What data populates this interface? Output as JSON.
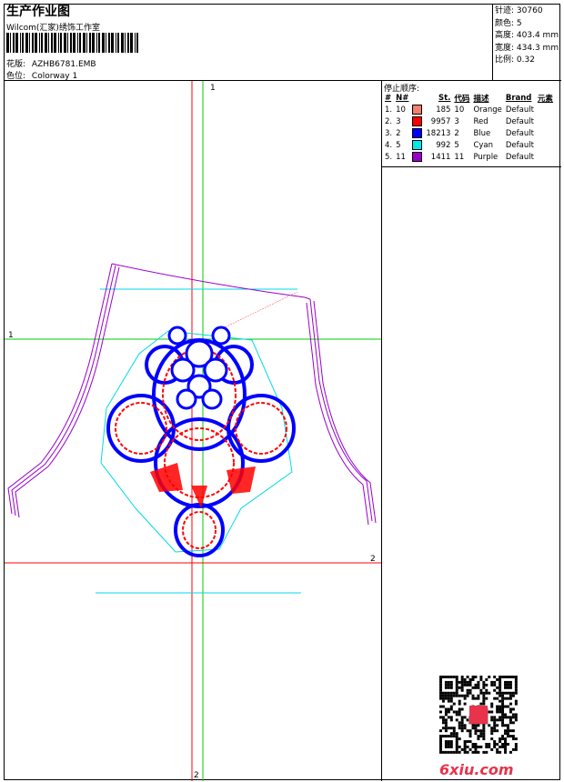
{
  "header": {
    "title": "生产作业图",
    "company": "Wilcom(汇家)绣饰工作室",
    "design_label": "花版:",
    "design_value": "AZHB6781.EMB",
    "colorway_label": "色位:",
    "colorway_value": "Colorway 1"
  },
  "stats": [
    {
      "label": "针迹:",
      "value": "30760"
    },
    {
      "label": "颜色:",
      "value": "5"
    },
    {
      "label": "高度:",
      "value": "403.4 mm"
    },
    {
      "label": "宽度:",
      "value": "434.3 mm"
    },
    {
      "label": "比例:",
      "value": "0.32"
    }
  ],
  "stop_table": {
    "title": "停止顺序:",
    "headers": [
      "#",
      "N#",
      "St.",
      "代码",
      "描述",
      "Brand",
      "元素"
    ],
    "rows": [
      {
        "idx": "1.",
        "n": "10",
        "color": "#f08070",
        "st": "185",
        "code": "10",
        "desc": "Orange",
        "brand": "Default"
      },
      {
        "idx": "2.",
        "n": "3",
        "color": "#ff0000",
        "st": "9957",
        "code": "3",
        "desc": "Red",
        "brand": "Default"
      },
      {
        "idx": "3.",
        "n": "2",
        "color": "#0000ff",
        "st": "18213",
        "code": "2",
        "desc": "Blue",
        "brand": "Default"
      },
      {
        "idx": "4.",
        "n": "5",
        "color": "#00e8e8",
        "st": "992",
        "code": "5",
        "desc": "Cyan",
        "brand": "Default"
      },
      {
        "idx": "5.",
        "n": "11",
        "color": "#9900cc",
        "st": "1411",
        "code": "11",
        "desc": "Purple",
        "brand": "Default"
      }
    ]
  },
  "axes": {
    "v_top": "1",
    "h_left": "1",
    "h_right": "2",
    "v_bottom": "2"
  },
  "watermark": "6xiu.com",
  "colors": {
    "red": "#ff0000",
    "blue": "#0000ff",
    "cyan": "#00d8e8",
    "purple": "#9900cc",
    "green": "#00cc00"
  }
}
